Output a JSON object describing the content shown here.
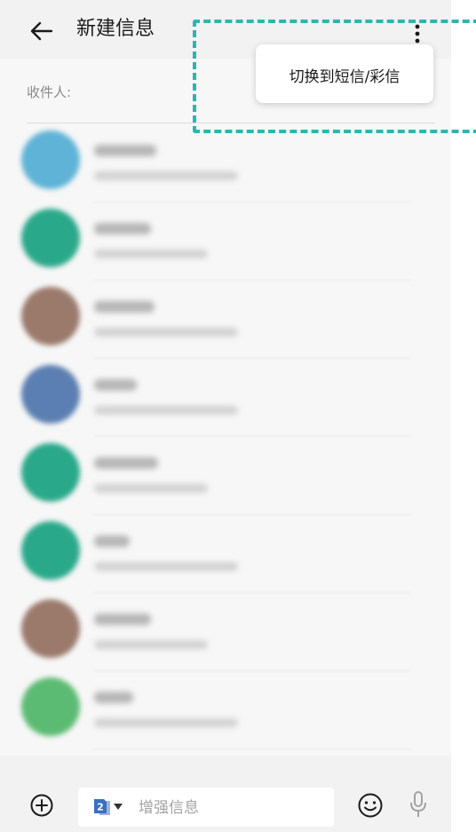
{
  "header": {
    "title": "新建信息"
  },
  "recipient": {
    "label": "收件人:"
  },
  "menu": {
    "items": [
      {
        "label": "切换到短信/彩信"
      }
    ]
  },
  "compose": {
    "placeholder": "增强信息",
    "sim_number": "2"
  },
  "contacts": [
    {
      "avatar_color": "#5fb3d6"
    },
    {
      "avatar_color": "#2aa88a"
    },
    {
      "avatar_color": "#9b7a6c"
    },
    {
      "avatar_color": "#5b7fb2"
    },
    {
      "avatar_color": "#2aa88a"
    },
    {
      "avatar_color": "#2aa88a"
    },
    {
      "avatar_color": "#9b7a6c"
    },
    {
      "avatar_color": "#5cbb73"
    }
  ],
  "colors": {
    "highlight": "#2fb5ad",
    "sim_badge": "#3b6fc4"
  },
  "icons": [
    "back-arrow-icon",
    "more-vertical-icon",
    "add-circle-icon",
    "sim-card-icon",
    "emoji-icon",
    "microphone-icon"
  ]
}
